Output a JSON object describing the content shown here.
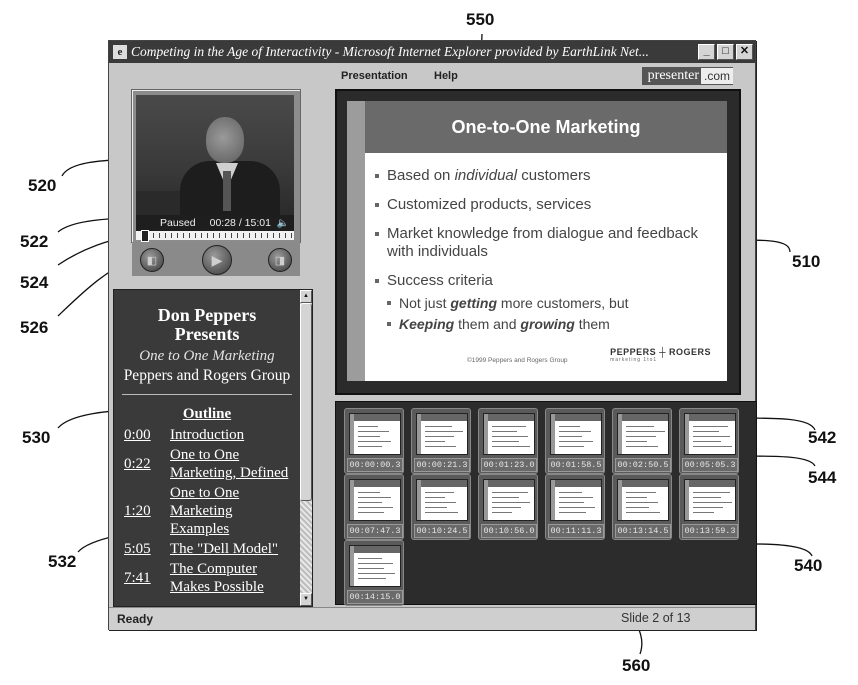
{
  "window": {
    "title": "Competing in the Age of Interactivity - Microsoft Internet Explorer provided by EarthLink Net...",
    "app_icon": "ie-icon",
    "controls": {
      "minimize": "_",
      "maximize": "□",
      "close": "✕"
    }
  },
  "menu": {
    "items": [
      {
        "label": "Presentation"
      },
      {
        "label": "Help"
      }
    ],
    "brand": {
      "name": "presenter",
      "suffix": ".com"
    }
  },
  "player": {
    "state": "Paused",
    "time": "00:28 / 15:01",
    "volume_icon": "🔈",
    "progress_fraction": 0.031,
    "buttons": {
      "prev": "◧",
      "play": "▶",
      "next": "◨"
    }
  },
  "outline": {
    "presenter": "Don Peppers",
    "presents": "Presents",
    "talk": "One to One Marketing",
    "org": "Peppers and Rogers Group",
    "heading": "Outline",
    "items": [
      {
        "time": "0:00",
        "title": "Introduction"
      },
      {
        "time": "0:22",
        "title": "One to One Marketing, Defined"
      },
      {
        "time": "1:20",
        "title": "One to One Marketing Examples"
      },
      {
        "time": "5:05",
        "title": "The \"Dell Model\""
      },
      {
        "time": "7:41",
        "title": "The Computer Makes Possible"
      }
    ]
  },
  "slide": {
    "title": "One-to-One Marketing",
    "bullets": [
      {
        "pre": "Based on ",
        "em": "individual",
        "post": " customers"
      },
      {
        "text": "Customized products, services"
      },
      {
        "text": "Market knowledge from dialogue and feedback with individuals"
      },
      {
        "text": "Success criteria"
      }
    ],
    "sub_bullets": [
      {
        "pre": "Not just ",
        "em": "getting",
        "post": " more customers, but"
      },
      {
        "em1": "Keeping",
        "mid": " them and ",
        "em2": "growing",
        "post": " them"
      }
    ],
    "footer": "©1999 Peppers and Rogers Group",
    "logo": "PEPPERS ┼ ROGERS",
    "logo_tag": "marketing 1to1"
  },
  "thumbnails": [
    {
      "time": "00:00:00.3"
    },
    {
      "time": "00:00:21.3"
    },
    {
      "time": "00:01:23.0"
    },
    {
      "time": "00:01:58.5"
    },
    {
      "time": "00:02:50.5"
    },
    {
      "time": "00:05:05.3"
    },
    {
      "time": "00:07:47.3"
    },
    {
      "time": "00:10:24.5"
    },
    {
      "time": "00:10:56.0"
    },
    {
      "time": "00:11:11.3"
    },
    {
      "time": "00:13:14.5"
    },
    {
      "time": "00:13:59.3"
    },
    {
      "time": "00:14:15.0"
    }
  ],
  "statusbar": {
    "ready": "Ready",
    "slide_indicator": "Slide 2 of 13"
  },
  "reference_numerals": {
    "n550": "550",
    "n520": "520",
    "n522": "522",
    "n524": "524",
    "n526": "526",
    "n510": "510",
    "n530": "530",
    "n532": "532",
    "n542": "542",
    "n544": "544",
    "n540": "540",
    "n560": "560"
  }
}
